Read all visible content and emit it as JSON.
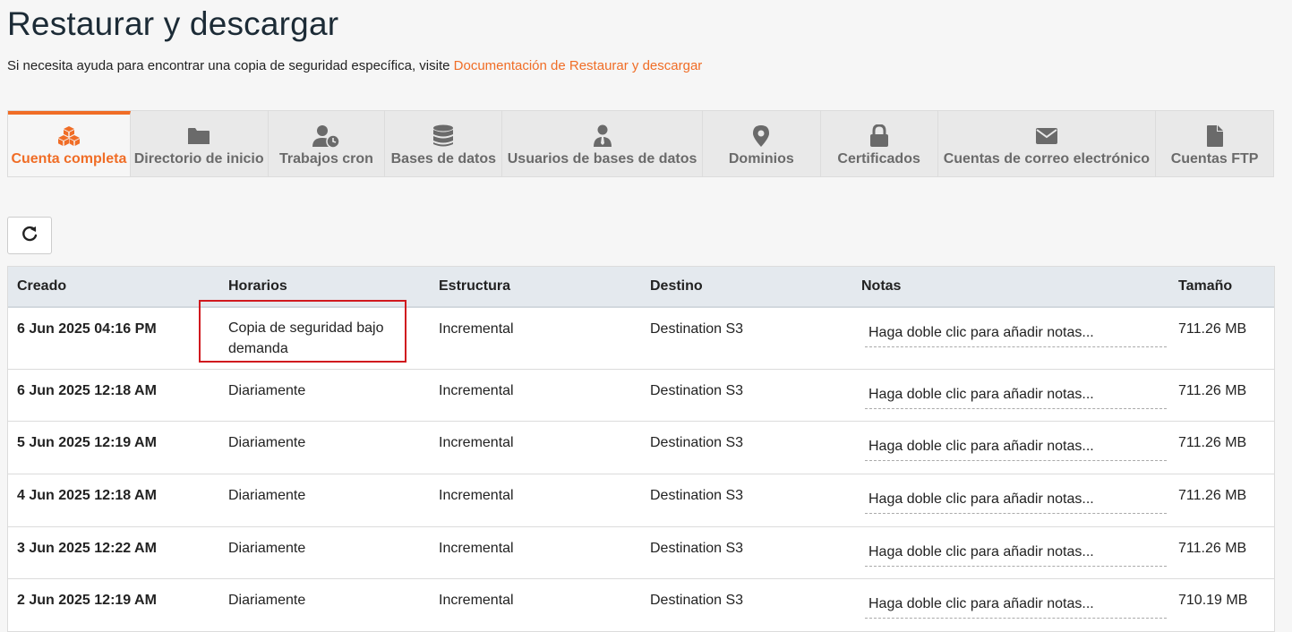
{
  "page": {
    "title": "Restaurar y descargar",
    "help_text": "Si necesita ayuda para encontrar una copia de seguridad específica, visite ",
    "help_link": "Documentación de Restaurar y descargar"
  },
  "tabs": [
    {
      "label": "Cuenta completa",
      "icon": "cubes-icon",
      "active": true
    },
    {
      "label": "Directorio de inicio",
      "icon": "folder-icon"
    },
    {
      "label": "Trabajos cron",
      "icon": "user-clock-icon"
    },
    {
      "label": "Bases de datos",
      "icon": "database-icon"
    },
    {
      "label": "Usuarios de bases de datos",
      "icon": "user-tie-icon"
    },
    {
      "label": "Dominios",
      "icon": "map-marker-icon"
    },
    {
      "label": "Certificados",
      "icon": "lock-icon"
    },
    {
      "label": "Cuentas de correo electrónico",
      "icon": "envelope-icon"
    },
    {
      "label": "Cuentas FTP",
      "icon": "file-icon"
    }
  ],
  "toolbar": {
    "refresh_icon": "refresh-icon"
  },
  "table": {
    "headers": [
      "Creado",
      "Horarios",
      "Estructura",
      "Destino",
      "Notas",
      "Tamaño"
    ],
    "notes_placeholder": "Haga doble clic para añadir notas...",
    "rows": [
      {
        "created": "6 Jun 2025 04:16 PM",
        "schedule": "Copia de seguridad bajo demanda",
        "structure": "Incremental",
        "destination": "Destination S3",
        "notes": "Haga doble clic para añadir notas...",
        "size": "711.26 MB"
      },
      {
        "created": "6 Jun 2025 12:18 AM",
        "schedule": "Diariamente",
        "structure": "Incremental",
        "destination": "Destination S3",
        "notes": "Haga doble clic para añadir notas...",
        "size": "711.26 MB"
      },
      {
        "created": "5 Jun 2025 12:19 AM",
        "schedule": "Diariamente",
        "structure": "Incremental",
        "destination": "Destination S3",
        "notes": "Haga doble clic para añadir notas...",
        "size": "711.26 MB"
      },
      {
        "created": "4 Jun 2025 12:18 AM",
        "schedule": "Diariamente",
        "structure": "Incremental",
        "destination": "Destination S3",
        "notes": "Haga doble clic para añadir notas...",
        "size": "711.26 MB"
      },
      {
        "created": "3 Jun 2025 12:22 AM",
        "schedule": "Diariamente",
        "structure": "Incremental",
        "destination": "Destination S3",
        "notes": "Haga doble clic para añadir notas...",
        "size": "711.26 MB"
      },
      {
        "created": "2 Jun 2025 12:19 AM",
        "schedule": "Diariamente",
        "structure": "Incremental",
        "destination": "Destination S3",
        "notes": "Haga doble clic para añadir notas...",
        "size": "710.19 MB"
      }
    ]
  },
  "colors": {
    "accent": "#f06d26",
    "highlight": "#d0191e",
    "header_bg": "#e4e9ee"
  }
}
